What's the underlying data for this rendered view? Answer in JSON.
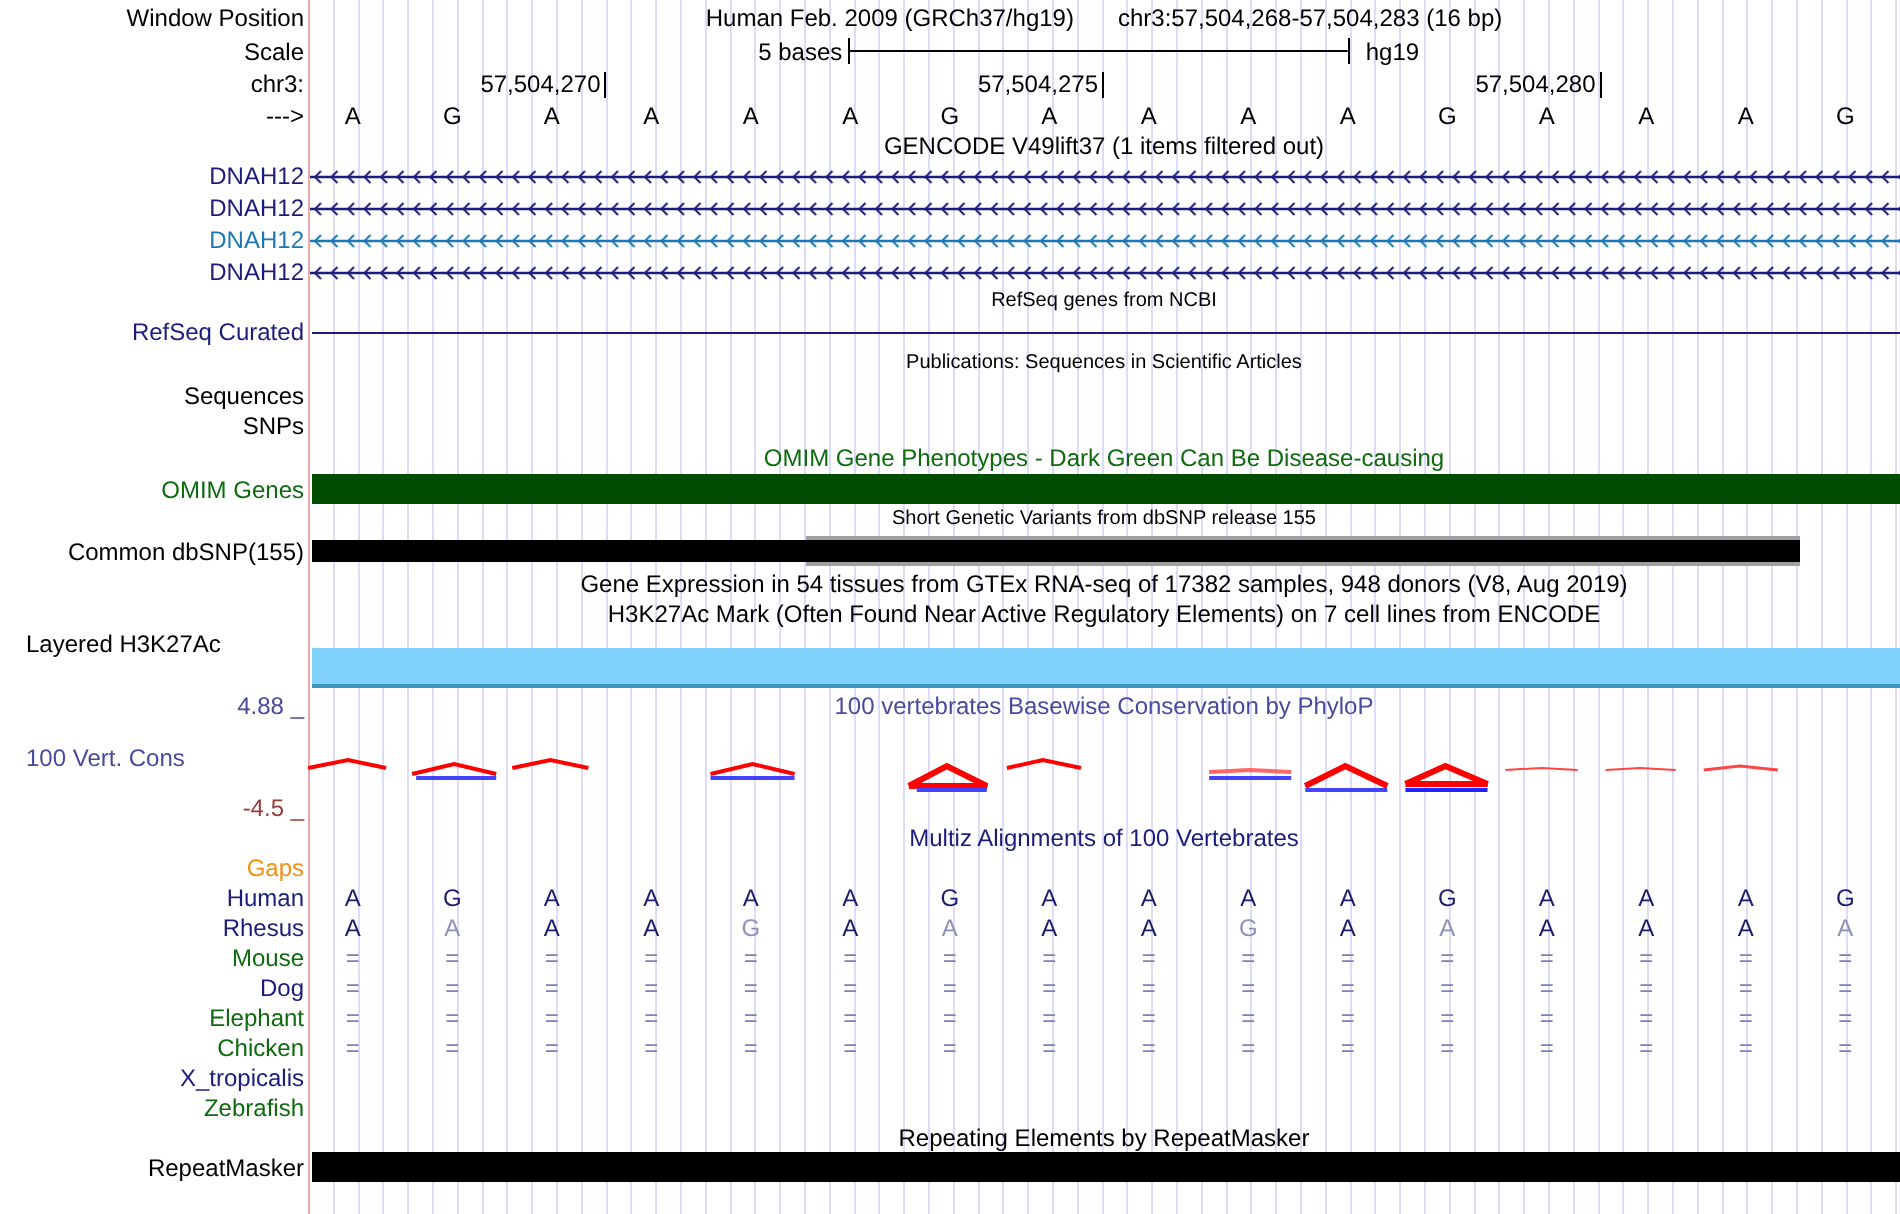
{
  "header": {
    "window_label": "Window Position",
    "assembly": "Human Feb. 2009 (GRCh37/hg19)",
    "position": "chr3:57,504,268-57,504,283 (16 bp)"
  },
  "ruler": {
    "scale_label": "Scale",
    "scale_text": "5 bases",
    "scale_assembly": "hg19",
    "chrom_label": "chr3:",
    "ticks": [
      "57,504,270",
      "57,504,275",
      "57,504,280"
    ],
    "strand_label": "--->",
    "bases": [
      "A",
      "G",
      "A",
      "A",
      "A",
      "A",
      "G",
      "A",
      "A",
      "A",
      "A",
      "G",
      "A",
      "A",
      "A",
      "G"
    ]
  },
  "gencode": {
    "title": "GENCODE V49lift37 (1 items filtered out)",
    "items": [
      {
        "name": "DNAH12",
        "color": "#1c1c7c"
      },
      {
        "name": "DNAH12",
        "color": "#1c1c7c"
      },
      {
        "name": "DNAH12",
        "color": "#1c78b4"
      },
      {
        "name": "DNAH12",
        "color": "#1c1c7c"
      }
    ]
  },
  "refseq": {
    "title": "RefSeq genes from NCBI",
    "label": "RefSeq Curated"
  },
  "publications": {
    "title": "Publications: Sequences in Scientific Articles",
    "labels": [
      "Sequences",
      "SNPs"
    ]
  },
  "omim": {
    "title": "OMIM Gene Phenotypes - Dark Green Can Be Disease-causing",
    "label": "OMIM Genes"
  },
  "dbsnp": {
    "title": "Short Genetic Variants from dbSNP release 155",
    "label": "Common dbSNP(155)"
  },
  "gtex": {
    "title": "Gene Expression in 54 tissues from GTEx RNA-seq of 17382 samples, 948 donors (V8, Aug 2019)"
  },
  "h3k27ac": {
    "title": "H3K27Ac Mark (Often Found Near Active Regulatory Elements) on 7 cell lines from ENCODE",
    "label": "Layered H3K27Ac"
  },
  "phylop": {
    "title": "100 vertebrates Basewise Conservation by PhyloP",
    "label": "100 Vert. Cons",
    "max_label": "4.88 _",
    "min_label": "-4.5 _"
  },
  "multiz": {
    "title": "Multiz Alignments of 100 Vertebrates",
    "gaps_label": "Gaps",
    "species": [
      {
        "name": "Human",
        "color": "#1c1c7c",
        "kind": "reference",
        "bases": [
          "A",
          "G",
          "A",
          "A",
          "A",
          "A",
          "G",
          "A",
          "A",
          "A",
          "A",
          "G",
          "A",
          "A",
          "A",
          "G"
        ]
      },
      {
        "name": "Rhesus",
        "color": "#1c1c7c",
        "kind": "aligned",
        "bases": [
          "A",
          "A",
          "A",
          "A",
          "G",
          "A",
          "A",
          "A",
          "A",
          "G",
          "A",
          "A",
          "A",
          "A",
          "A",
          "A"
        ],
        "dimmed": [
          false,
          true,
          false,
          false,
          true,
          false,
          true,
          false,
          false,
          true,
          false,
          true,
          false,
          false,
          false,
          true
        ]
      },
      {
        "name": "Mouse",
        "color": "#0e6a0e",
        "kind": "match",
        "bases": [
          "=",
          "=",
          "=",
          "=",
          "=",
          "=",
          "=",
          "=",
          "=",
          "=",
          "=",
          "=",
          "=",
          "=",
          "=",
          "="
        ]
      },
      {
        "name": "Dog",
        "color": "#1c1c7c",
        "kind": "match",
        "bases": [
          "=",
          "=",
          "=",
          "=",
          "=",
          "=",
          "=",
          "=",
          "=",
          "=",
          "=",
          "=",
          "=",
          "=",
          "=",
          "="
        ]
      },
      {
        "name": "Elephant",
        "color": "#0e6a0e",
        "kind": "match",
        "bases": [
          "=",
          "=",
          "=",
          "=",
          "=",
          "=",
          "=",
          "=",
          "=",
          "=",
          "=",
          "=",
          "=",
          "=",
          "=",
          "="
        ]
      },
      {
        "name": "Chicken",
        "color": "#0e6a0e",
        "kind": "match",
        "bases": [
          "=",
          "=",
          "=",
          "=",
          "=",
          "=",
          "=",
          "=",
          "=",
          "=",
          "=",
          "=",
          "=",
          "=",
          "=",
          "="
        ]
      },
      {
        "name": "X_tropicalis",
        "color": "#1c1c7c",
        "kind": "empty"
      },
      {
        "name": "Zebrafish",
        "color": "#0e6a0e",
        "kind": "empty"
      }
    ]
  },
  "repeatmasker": {
    "title": "Repeating Elements by RepeatMasker",
    "label": "RepeatMasker"
  }
}
